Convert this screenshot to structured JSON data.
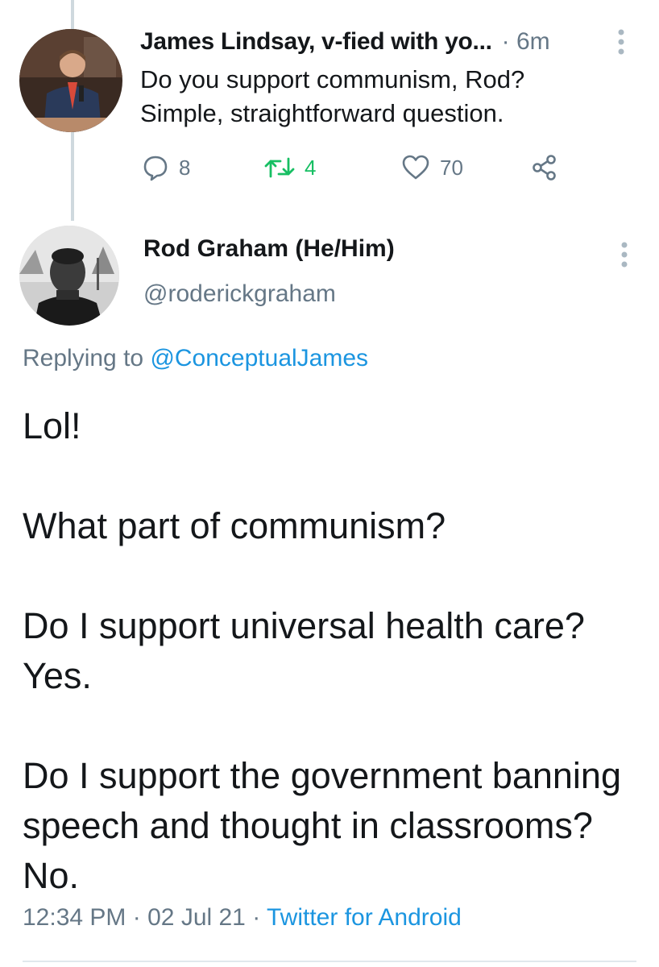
{
  "tweet1": {
    "author": "James Lindsay, v-fied with yo...",
    "time": "· 6m",
    "text_line1": "Do you support communism, Rod?",
    "text_line2": "Simple, straightforward question.",
    "actions": {
      "reply_icon": "reply-icon",
      "reply_count": "8",
      "retweet_icon": "retweet-icon",
      "retweet_count": "4",
      "like_icon": "heart-icon",
      "like_count": "70",
      "share_icon": "share-icon"
    }
  },
  "tweet2": {
    "author": "Rod Graham (He/Him)",
    "handle": "@roderickgraham",
    "replying_prefix": "Replying to",
    "replying_mention": "@ConceptualJames",
    "paragraphs": [
      "Lol!",
      "What part of communism?",
      "Do I support universal health care? Yes.",
      "Do I support the government banning speech and thought in classrooms? No."
    ],
    "time": "12:34 PM",
    "separator1": "·",
    "date": "02 Jul 21",
    "separator2": "·",
    "source": "Twitter for Android"
  },
  "colors": {
    "accent": "#1b95e0",
    "retweet": "#17bf63",
    "muted": "#657786",
    "text": "#14171a"
  }
}
